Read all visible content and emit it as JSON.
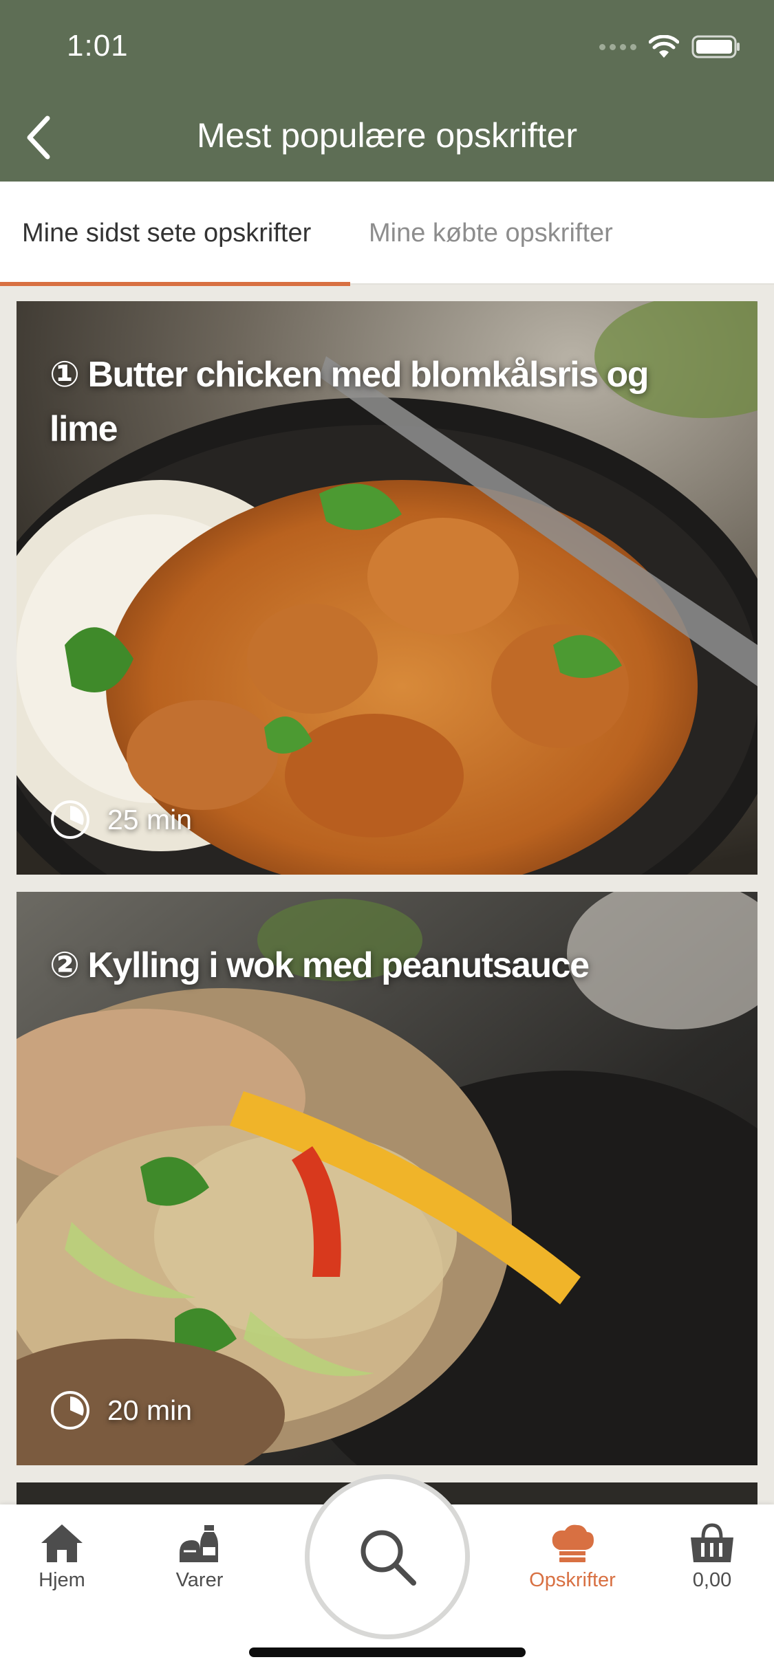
{
  "status_bar": {
    "time": "1:01"
  },
  "header": {
    "title": "Mest populære opskrifter"
  },
  "tabs": [
    {
      "label": "Mine sidst sete opskrifter",
      "active": true
    },
    {
      "label": "Mine købte opskrifter",
      "active": false
    }
  ],
  "recipes": [
    {
      "rank": "①",
      "title": "Butter chicken med blomkålsris og lime",
      "time": "25 min"
    },
    {
      "rank": "②",
      "title": "Kylling i wok med peanutsauce",
      "time": "20 min"
    }
  ],
  "bottom_nav": {
    "home_label": "Hjem",
    "products_label": "Varer",
    "recipes_label": "Opskrifter",
    "basket_label": "0,00"
  },
  "colors": {
    "header": "#5e6e55",
    "accent": "#d87042"
  }
}
